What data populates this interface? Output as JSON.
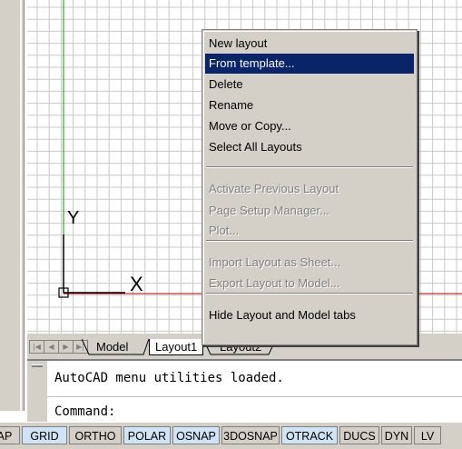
{
  "tabs": {
    "model": "Model",
    "layout1": "Layout1",
    "layout2": "Layout2"
  },
  "context_menu": {
    "items": [
      {
        "label": "New layout",
        "state": "normal"
      },
      {
        "label": "From template...",
        "state": "selected"
      },
      {
        "label": "Delete",
        "state": "normal"
      },
      {
        "label": "Rename",
        "state": "normal"
      },
      {
        "label": "Move or Copy...",
        "state": "normal"
      },
      {
        "label": "Select All Layouts",
        "state": "normal"
      },
      {
        "label": "Activate Previous Layout",
        "state": "disabled"
      },
      {
        "label": "Page Setup Manager...",
        "state": "disabled"
      },
      {
        "label": "Plot...",
        "state": "disabled"
      },
      {
        "label": "Import Layout as Sheet...",
        "state": "disabled"
      },
      {
        "label": "Export Layout to Model...",
        "state": "disabled"
      },
      {
        "label": "Hide Layout and Model tabs",
        "state": "normal"
      }
    ]
  },
  "ucs": {
    "y_label": "Y",
    "x_label": "X"
  },
  "command": {
    "history_line": "AutoCAD menu utilities loaded.",
    "prompt": "Command:"
  },
  "status_bar": {
    "buttons": [
      {
        "label": "AP",
        "on": false
      },
      {
        "label": "GRID",
        "on": true
      },
      {
        "label": "ORTHO",
        "on": false
      },
      {
        "label": "POLAR",
        "on": true
      },
      {
        "label": "OSNAP",
        "on": true
      },
      {
        "label": "3DOSNAP",
        "on": false
      },
      {
        "label": "OTRACK",
        "on": true
      },
      {
        "label": "DUCS",
        "on": false
      },
      {
        "label": "DYN",
        "on": false
      },
      {
        "label": "LV",
        "on": false
      }
    ]
  },
  "colors": {
    "grid": "#c8c8c8",
    "menu_highlight": "#0a246a",
    "status_on": "#cfe4f5",
    "axis_green": "#00a000",
    "axis_red": "#c00000"
  }
}
